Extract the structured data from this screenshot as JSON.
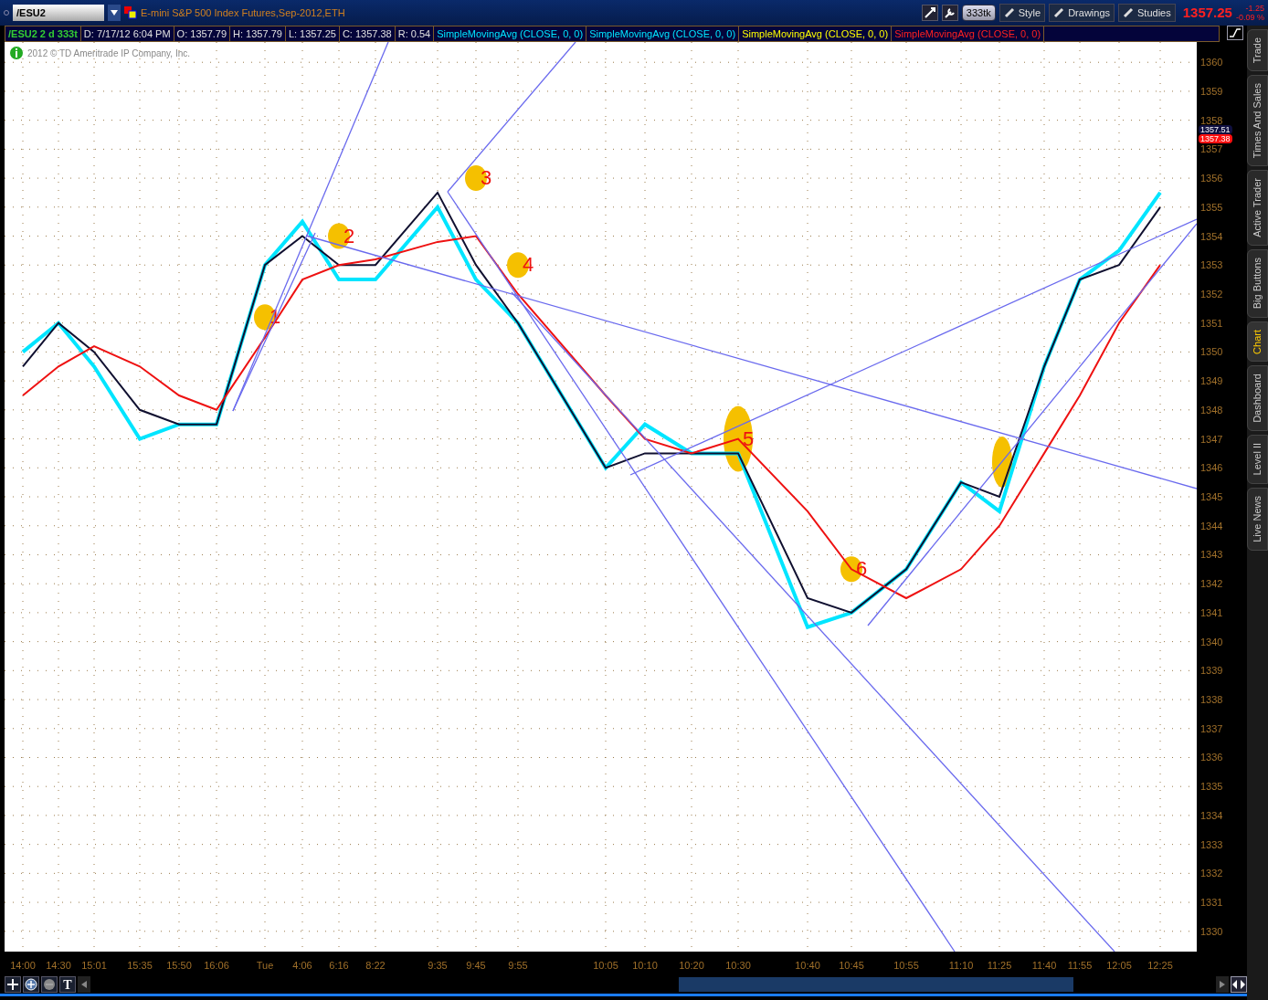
{
  "toolbar": {
    "symbol": "/ESU2",
    "title": "E-mini S&P 500 Index Futures,Sep-2012,ETH",
    "aggregation": "333tk",
    "buttons": [
      "Style",
      "Drawings",
      "Studies"
    ],
    "last_price": "1357.25",
    "change": "-1.25",
    "change_percent": "-0.09 %"
  },
  "legend": [
    {
      "text": "/ESU2 2 d 333t",
      "color": "#33cc33"
    },
    {
      "text": "D: 7/17/12 6:04 PM",
      "color": "#e0e0e0"
    },
    {
      "text": "O: 1357.79",
      "color": "#e0e0e0"
    },
    {
      "text": "H: 1357.79",
      "color": "#e0e0e0"
    },
    {
      "text": "L: 1357.25",
      "color": "#e0e0e0"
    },
    {
      "text": "C: 1357.38",
      "color": "#e0e0e0"
    },
    {
      "text": "R: 0.54",
      "color": "#e0e0e0"
    },
    {
      "text": "SimpleMovingAvg (CLOSE, 0, 0)",
      "color": "#00e5ff"
    },
    {
      "text": "SimpleMovingAvg (CLOSE, 0, 0)",
      "color": "#00e5ff"
    },
    {
      "text": "SimpleMovingAvg (CLOSE, 0, 0)",
      "color": "#ffff00"
    },
    {
      "text": "SimpleMovingAvg (CLOSE, 0, 0)",
      "color": "#ff2020"
    }
  ],
  "copyright": "2012 © TD Ameritrade IP Company, Inc.",
  "price_badges": [
    "1357.51",
    "1357.38"
  ],
  "chart": {
    "chart_data": {
      "type": "line",
      "categories": [
        "14:00",
        "14:30",
        "15:01",
        "15:35",
        "15:50",
        "16:06",
        "Tue",
        "4:06",
        "6:16",
        "8:22",
        "9:35",
        "9:45",
        "9:55",
        "10:05",
        "10:10",
        "10:20",
        "10:30",
        "10:40",
        "10:45",
        "10:55",
        "11:10",
        "11:25",
        "11:40",
        "11:55",
        "12:05",
        "12:25"
      ],
      "grid": true,
      "series": [
        {
          "color": "#00e5ff",
          "values": [
            1350,
            1351,
            1349.5,
            1347,
            1347.5,
            1347.5,
            1353,
            1354.5,
            1352.5,
            1352.5,
            1355,
            1352.5,
            1351,
            1346,
            1347.5,
            1346.5,
            1346.5,
            1340.5,
            1341,
            1342.5,
            1345.5,
            1344.5,
            1349.5,
            1352.5,
            1353.5,
            1355.5
          ]
        },
        {
          "color": "#101030",
          "values": [
            1349.5,
            1351,
            1350,
            1348,
            1347.5,
            1347.5,
            1353,
            1354,
            1353,
            1353,
            1355.5,
            1353,
            1351,
            1346,
            1346.5,
            1346.5,
            1346.5,
            1341.5,
            1341,
            1342.5,
            1345.5,
            1345,
            1349.5,
            1352.5,
            1353,
            1355
          ]
        },
        {
          "color": "#ee1111",
          "values": [
            1348.5,
            1349.5,
            1350.2,
            1349.5,
            1348.5,
            1348,
            1350.5,
            1352.5,
            1353,
            1353.2,
            1353.8,
            1354,
            1352,
            1348.5,
            1347,
            1346.5,
            1347,
            1344.5,
            1342.5,
            1341.5,
            1342.5,
            1344,
            1346.5,
            1348.5,
            1351,
            1353
          ]
        }
      ],
      "ylim": [
        1329.3,
        1360.7
      ],
      "yticks": [
        1330,
        1331,
        1332,
        1333,
        1334,
        1335,
        1336,
        1337,
        1338,
        1339,
        1340,
        1341,
        1342,
        1343,
        1344,
        1345,
        1346,
        1347,
        1348,
        1349,
        1350,
        1351,
        1352,
        1353,
        1354,
        1355,
        1356,
        1357,
        1358,
        1359,
        1360
      ],
      "annotations": [
        {
          "text": "1",
          "x": "Tue",
          "y": 1351.2
        },
        {
          "text": "2",
          "x": "6:16",
          "y": 1354
        },
        {
          "text": "3",
          "x": "9:45",
          "y": 1356
        },
        {
          "text": "4",
          "x": "9:55",
          "y": 1353
        },
        {
          "text": "5",
          "x": "10:30",
          "y": 1347
        },
        {
          "text": "6",
          "x": "10:45",
          "y": 1342.5
        }
      ]
    }
  },
  "side_tabs": [
    {
      "label": "Trade",
      "selected": false
    },
    {
      "label": "Times And Sales",
      "selected": false
    },
    {
      "label": "Active Trader",
      "selected": false
    },
    {
      "label": "Big Buttons",
      "selected": false
    },
    {
      "label": "Chart",
      "selected": true
    },
    {
      "label": "Dashboard",
      "selected": false
    },
    {
      "label": "Level II",
      "selected": false
    },
    {
      "label": "Live News",
      "selected": false
    }
  ],
  "bottom_tools": [
    {
      "kind": "crosshair"
    },
    {
      "kind": "zoom-in"
    },
    {
      "kind": "zoom-out"
    },
    {
      "kind": "text",
      "label": "T"
    }
  ]
}
